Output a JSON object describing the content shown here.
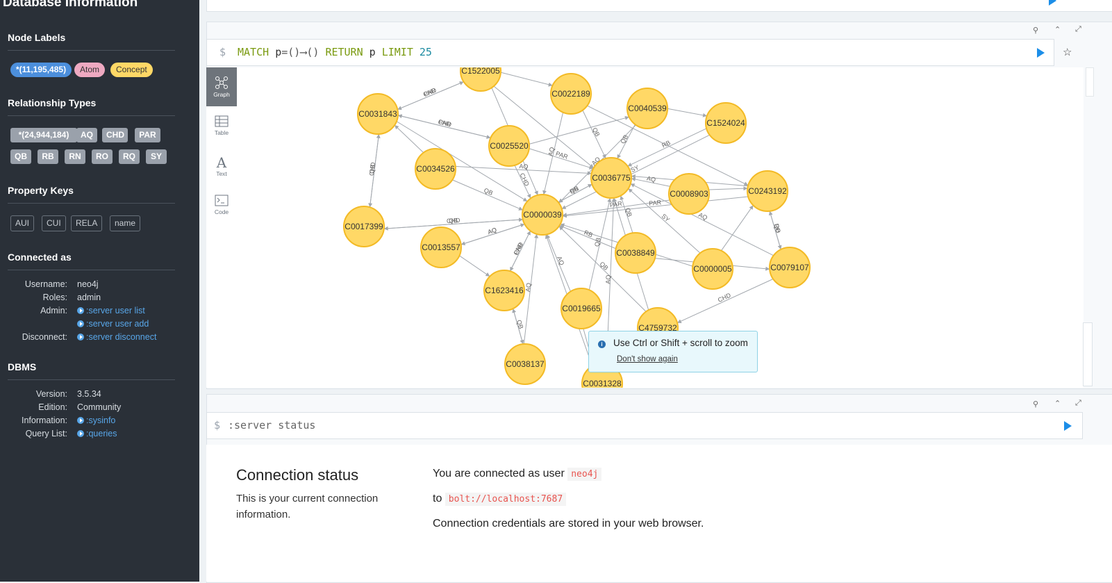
{
  "sidebar": {
    "title": "Database Information",
    "node_labels": {
      "heading": "Node Labels",
      "items": [
        "*(11,195,485)",
        "Atom",
        "Concept"
      ],
      "colors": [
        "#4c8fdc",
        "#eea9c1",
        "#ffd866"
      ]
    },
    "relationship_types": {
      "heading": "Relationship Types",
      "items": [
        "*(24,944,184)",
        "AQ",
        "CHD",
        "PAR",
        "QB",
        "RB",
        "RN",
        "RO",
        "RQ",
        "SY"
      ]
    },
    "property_keys": {
      "heading": "Property Keys",
      "items": [
        "AUI",
        "CUI",
        "RELA",
        "name"
      ]
    },
    "connected_as": {
      "heading": "Connected as",
      "username_label": "Username:",
      "username": "neo4j",
      "roles_label": "Roles:",
      "roles": "admin",
      "admin_label": "Admin:",
      "admin_links": [
        ":server user list",
        ":server user add"
      ],
      "disconnect_label": "Disconnect:",
      "disconnect_link": ":server disconnect"
    },
    "dbms": {
      "heading": "DBMS",
      "version_label": "Version:",
      "version": "3.5.34",
      "edition_label": "Edition:",
      "edition": "Community",
      "information_label": "Information:",
      "information_link": ":sysinfo",
      "query_list_label": "Query List:",
      "query_list_link": ":queries"
    }
  },
  "query_frame": {
    "prompt": "$",
    "query": {
      "match": "MATCH",
      "p": "p",
      "pattern": "=()⟶()",
      "return": "RETURN",
      "p2": "p",
      "limit": "LIMIT",
      "n": "25"
    },
    "tabs": [
      "Graph",
      "Table",
      "Text",
      "Code"
    ],
    "active_tab": "Graph"
  },
  "graph": {
    "nodes": [
      "C1522005",
      "C0022189",
      "C0040539",
      "C0031843",
      "C1524024",
      "C0025520",
      "C0034526",
      "C0036775",
      "C0008903",
      "C0243192",
      "C0017399",
      "C0000039",
      "C0013557",
      "C0038849",
      "C0000005",
      "C0079107",
      "C1623416",
      "C0019665",
      "C4759732",
      "C0038137",
      "C0031328"
    ],
    "edge_labels": [
      "CHD",
      "PAR",
      "CHD",
      "PAR",
      "QB",
      "CHD",
      "PAR",
      "AQ",
      "QB",
      "QB",
      "AQ",
      "RB",
      "SY",
      "CHD",
      "PAR",
      "QB",
      "AQ",
      "RN",
      "QB",
      "AQ",
      "PAR",
      "CHD",
      "PAR",
      "CHD",
      "QB",
      "AQ",
      "AQ",
      "QB",
      "RB",
      "SY",
      "PAR",
      "AQ",
      "QB",
      "RO",
      "CHD",
      "PAR",
      "AQ",
      "QB",
      "QB",
      "QB",
      "AQ",
      "QB",
      "RB",
      "AQ",
      "CHD",
      "QB"
    ]
  },
  "tooltip": {
    "message": "Use Ctrl or Shift + scroll to zoom",
    "dismiss": "Don't show again"
  },
  "status_frame": {
    "prompt": "$",
    "command": ":server status",
    "title": "Connection status",
    "description": "This is your current connection information.",
    "connected_prefix": "You are connected as user",
    "user": "neo4j",
    "to_prefix": "to",
    "url": "bolt://localhost:7687",
    "credentials_note": "Connection credentials are stored in your web browser."
  }
}
